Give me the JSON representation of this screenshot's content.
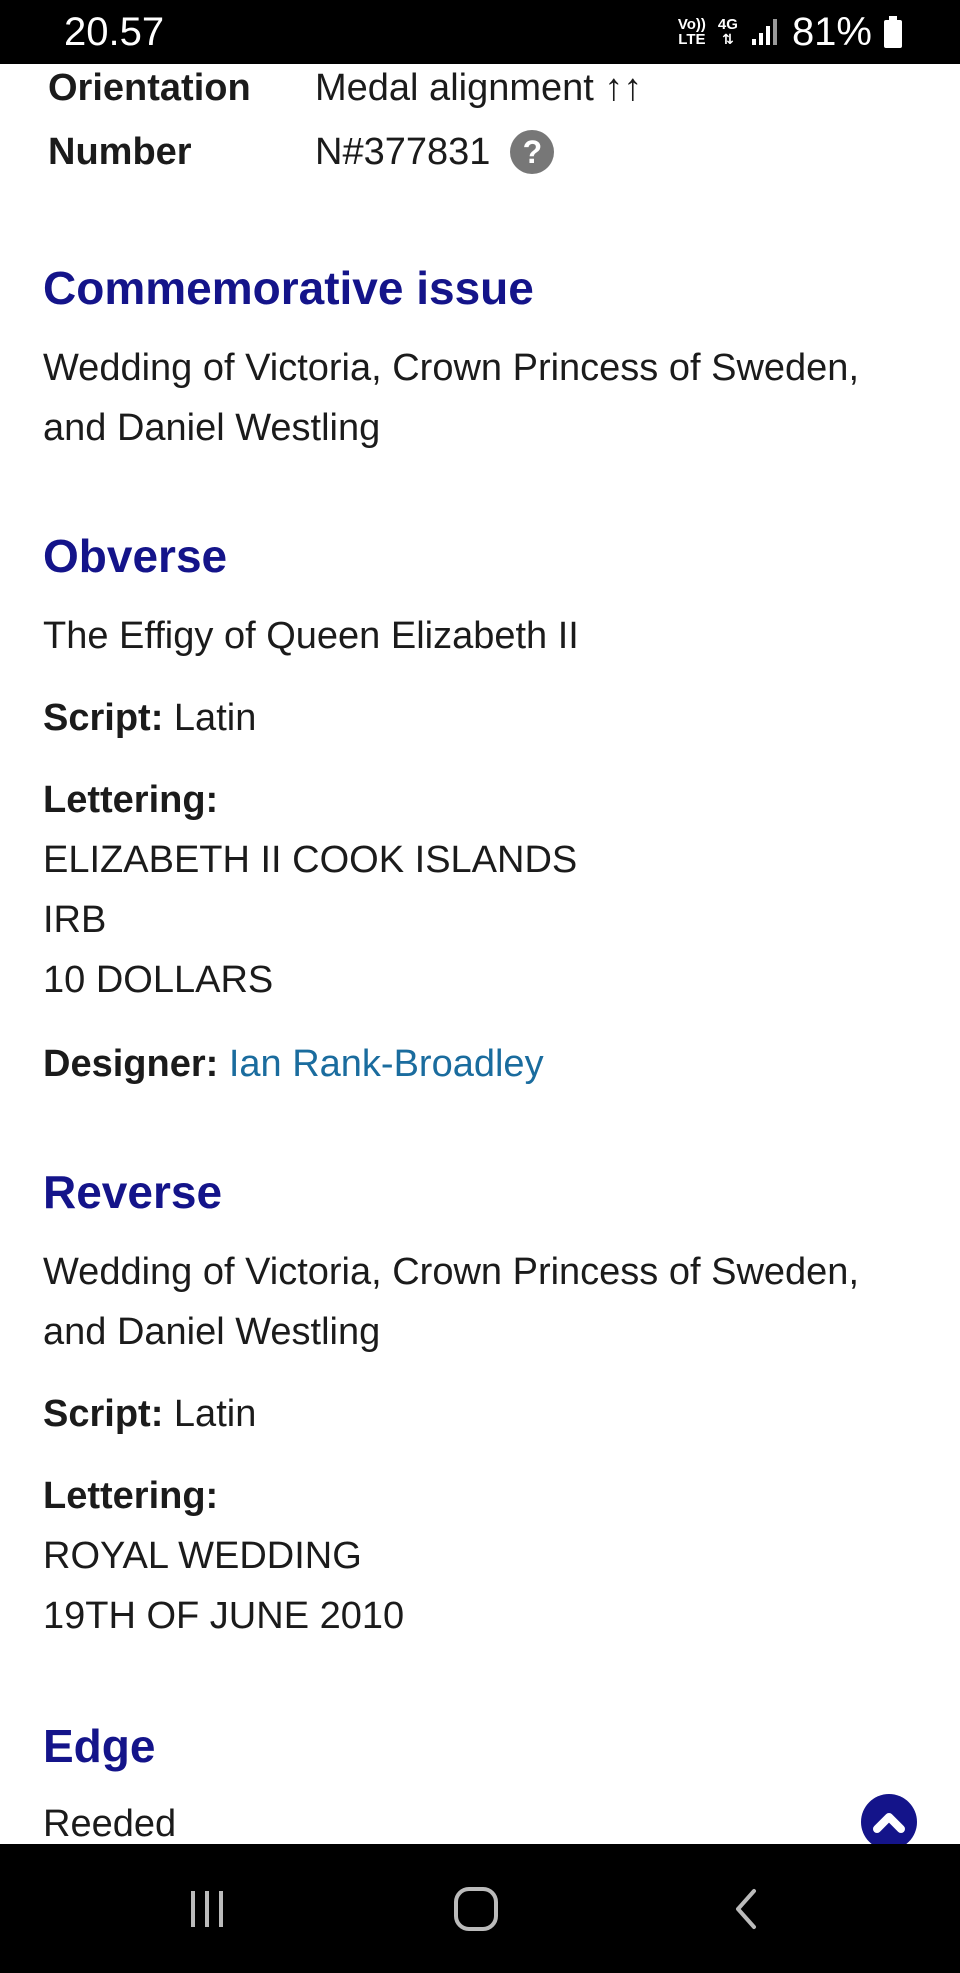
{
  "status_bar": {
    "time": "20.57",
    "network_top": "Vo))",
    "network_bottom": "LTE",
    "data_top": "4G",
    "battery": "81%"
  },
  "details": {
    "orientation_label": "Orientation",
    "orientation_value": "Medal alignment ↑↑",
    "number_label": "Number",
    "number_value": "N#377831",
    "help_icon": "question-icon"
  },
  "commemorative": {
    "heading": "Commemorative issue",
    "text_line1": "Wedding of Victoria, Crown Princess of Sweden,",
    "text_line2": "and Daniel Westling"
  },
  "obverse": {
    "heading": "Obverse",
    "description": "The Effigy of Queen Elizabeth II",
    "script_label": "Script:",
    "script_value": "Latin",
    "lettering_label": "Lettering:",
    "lettering_lines": [
      "ELIZABETH II COOK ISLANDS",
      "IRB",
      "10 DOLLARS"
    ],
    "designer_label": "Designer:",
    "designer_value": "Ian Rank-Broadley"
  },
  "reverse": {
    "heading": "Reverse",
    "text_line1": "Wedding of Victoria, Crown Princess of Sweden,",
    "text_line2": "and Daniel Westling",
    "script_label": "Script:",
    "script_value": "Latin",
    "lettering_label": "Lettering:",
    "lettering_lines": [
      "ROYAL WEDDING",
      "19TH OF JUNE 2010"
    ]
  },
  "edge": {
    "heading": "Edge",
    "value": "Reeded"
  },
  "colors": {
    "heading": "#14148a",
    "link": "#1a6c9e",
    "bars": "#000000"
  },
  "nav": {
    "recent_icon": "recent-apps-icon",
    "home_icon": "home-icon",
    "back_icon": "back-icon",
    "scroll_top_icon": "chevron-up-icon"
  }
}
